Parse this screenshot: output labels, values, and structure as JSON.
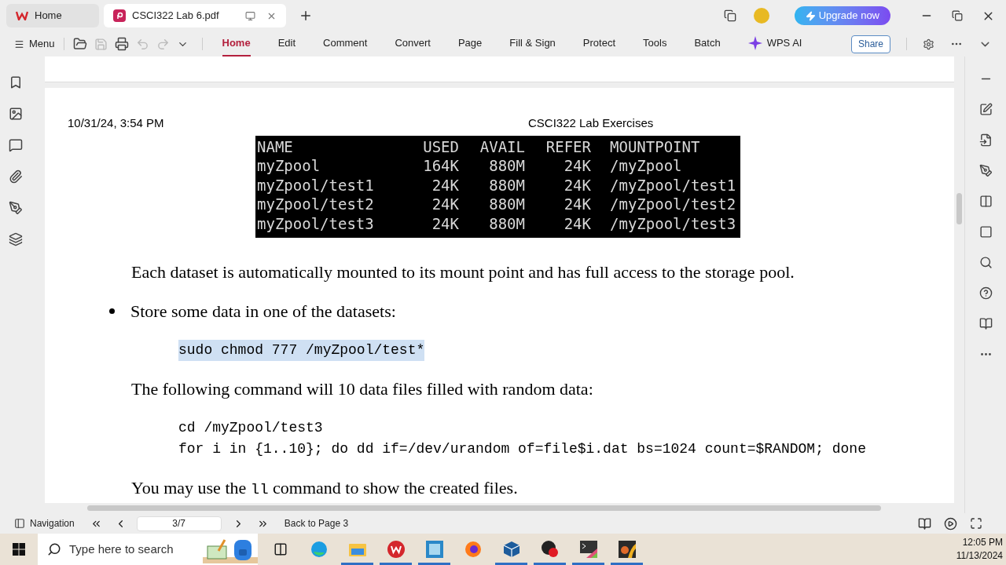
{
  "tabs": [
    {
      "label": "Home",
      "kind": "home",
      "selected": false
    },
    {
      "label": "CSCI322 Lab 6.pdf",
      "kind": "doc",
      "selected": true
    }
  ],
  "upgrade_button": "Upgrade now",
  "menu_button": "Menu",
  "ribbon_tabs": [
    {
      "label": "Home",
      "kind": "plain",
      "selected": true
    },
    {
      "label": "Edit",
      "kind": "plain",
      "selected": false
    },
    {
      "label": "Comment",
      "kind": "plain",
      "selected": false
    },
    {
      "label": "Convert",
      "kind": "plain",
      "selected": false
    },
    {
      "label": "Page",
      "kind": "plain",
      "selected": false
    },
    {
      "label": "Fill & Sign",
      "kind": "plain",
      "selected": false
    },
    {
      "label": "Protect",
      "kind": "plain",
      "selected": false
    },
    {
      "label": "Tools",
      "kind": "plain",
      "selected": false
    },
    {
      "label": "Batch",
      "kind": "plain",
      "selected": false
    },
    {
      "label": "WPS AI",
      "kind": "ai",
      "selected": false
    }
  ],
  "share_button": "Share",
  "document": {
    "header_date": "10/31/24, 3:54 PM",
    "header_title": "CSCI322 Lab Exercises",
    "terminal": {
      "columns": [
        "NAME",
        "USED",
        "AVAIL",
        "REFER",
        "MOUNTPOINT"
      ],
      "rows": [
        [
          "myZpool",
          "164K",
          "880M",
          "24K",
          "/myZpool"
        ],
        [
          "myZpool/test1",
          "24K",
          "880M",
          "24K",
          "/myZpool/test1"
        ],
        [
          "myZpool/test2",
          "24K",
          "880M",
          "24K",
          "/myZpool/test2"
        ],
        [
          "myZpool/test3",
          "24K",
          "880M",
          "24K",
          "/myZpool/test3"
        ]
      ]
    },
    "blocks": [
      {
        "kind": "paragraph",
        "parts": [
          {
            "text": "Each dataset is automatically mounted to its mount point and has full access to the storage pool.",
            "code": false
          }
        ]
      },
      {
        "kind": "bullet",
        "parts": [
          {
            "text": "Store some data in one of the datasets:",
            "code": false
          }
        ]
      },
      {
        "kind": "code",
        "highlighted": true,
        "lines": [
          "sudo chmod 777 /myZpool/test*"
        ]
      },
      {
        "kind": "paragraph",
        "parts": [
          {
            "text": "The following command will 10 data files filled with random data:",
            "code": false
          }
        ]
      },
      {
        "kind": "code",
        "highlighted": false,
        "lines": [
          "cd /myZpool/test3",
          "for i in {1..10}; do dd if=/dev/urandom of=file$i.dat bs=1024 count=$RANDOM; done"
        ]
      },
      {
        "kind": "paragraph",
        "parts": [
          {
            "text": "You may use the ",
            "code": false
          },
          {
            "text": "ll",
            "code": true
          },
          {
            "text": " command to show the created files.",
            "code": false
          }
        ]
      }
    ]
  },
  "status_bar": {
    "navigation": "Navigation",
    "page": "3/7",
    "back": "Back to Page 3"
  },
  "taskbar": {
    "search_placeholder": "Type here to search",
    "time": "12:05 PM",
    "date": "11/13/2024"
  }
}
